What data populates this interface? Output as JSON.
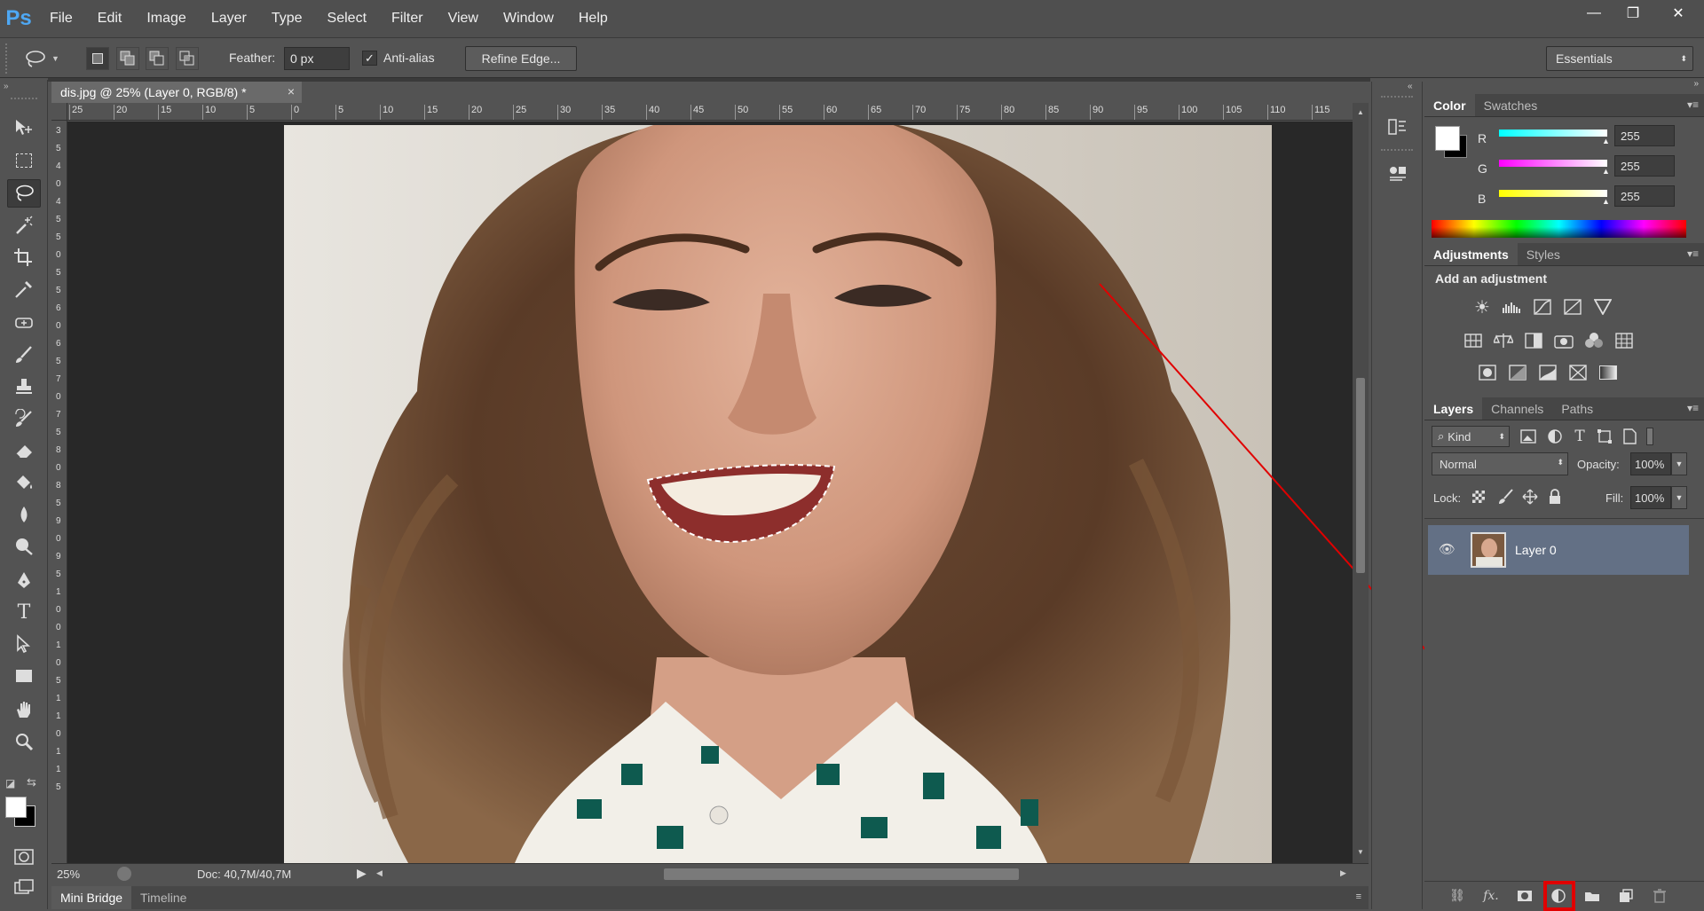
{
  "app": {
    "logo": "Ps"
  },
  "menu": [
    "File",
    "Edit",
    "Image",
    "Layer",
    "Type",
    "Select",
    "Filter",
    "View",
    "Window",
    "Help"
  ],
  "window_controls": {
    "minimize": "—",
    "restore": "❐",
    "close": "✕"
  },
  "options": {
    "feather_label": "Feather:",
    "feather_value": "0 px",
    "antialias_label": "Anti-alias",
    "antialias_checked": true,
    "refine_edge": "Refine Edge...",
    "workspace": "Essentials"
  },
  "document": {
    "tab_title": "dis.jpg @ 25% (Layer 0, RGB/8) *",
    "close": "×",
    "ruler_top": [
      "25",
      "20",
      "15",
      "10",
      "5",
      "0",
      "5",
      "10",
      "15",
      "20",
      "25",
      "30",
      "35",
      "40",
      "45",
      "50",
      "55",
      "60",
      "65",
      "70",
      "75",
      "80",
      "85",
      "90",
      "95",
      "100",
      "105",
      "110",
      "115"
    ],
    "ruler_left": [
      "3",
      "5",
      "4",
      "0",
      "4",
      "5",
      "5",
      "0",
      "5",
      "5",
      "6",
      "0",
      "6",
      "5",
      "7",
      "0",
      "7",
      "5",
      "8",
      "0",
      "8",
      "5",
      "9",
      "0",
      "9",
      "5",
      "1",
      "0",
      "0",
      "1",
      "0",
      "5",
      "1",
      "1",
      "0",
      "1",
      "1",
      "5"
    ],
    "zoom": "25%",
    "doc_info": "Doc: 40,7M/40,7M"
  },
  "bottom_tabs": [
    "Mini Bridge",
    "Timeline"
  ],
  "color_panel": {
    "tabs": [
      "Color",
      "Swatches"
    ],
    "channels": [
      {
        "label": "R",
        "value": "255",
        "color": "#00ffff"
      },
      {
        "label": "G",
        "value": "255",
        "color": "#ff00ff"
      },
      {
        "label": "B",
        "value": "255",
        "color": "#ffff00"
      }
    ]
  },
  "adjustments_panel": {
    "tabs": [
      "Adjustments",
      "Styles"
    ],
    "heading": "Add an adjustment"
  },
  "layers_panel": {
    "tabs": [
      "Layers",
      "Channels",
      "Paths"
    ],
    "kind": "Kind",
    "blend_mode": "Normal",
    "opacity_label": "Opacity:",
    "opacity": "100%",
    "lock_label": "Lock:",
    "fill_label": "Fill:",
    "fill": "100%",
    "layers": [
      {
        "name": "Layer 0",
        "visible": true
      }
    ]
  },
  "colors": {
    "highlight_red": "#e00000",
    "layer_selected": "#637085",
    "ps_blue": "#4ea8f4"
  }
}
